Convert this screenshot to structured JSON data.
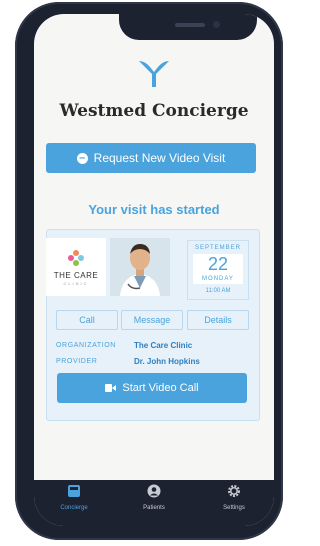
{
  "app": {
    "title": "Westmed Concierge"
  },
  "actions": {
    "request_visit": "Request New Video Visit"
  },
  "visit": {
    "status": "Your visit has started",
    "clinic_logo_text": "THE CARE",
    "clinic_logo_sub": "CLINIC",
    "date": {
      "month": "SEPTEMBER",
      "day": "22",
      "weekday": "MONDAY",
      "time": "11:00 AM"
    },
    "buttons": {
      "call": "Call",
      "message": "Message",
      "details": "Details"
    },
    "organization_label": "ORGANIZATION",
    "organization_value": "The Care Clinic",
    "provider_label": "PROVIDER",
    "provider_value": "Dr. John Hopkins",
    "start_call": "Start Video Call"
  },
  "tabs": [
    {
      "label": "Concierge",
      "icon": "concierge-icon",
      "active": true
    },
    {
      "label": "Patients",
      "icon": "patient-icon",
      "active": false
    },
    {
      "label": "Settings",
      "icon": "gear-icon",
      "active": false
    }
  ],
  "colors": {
    "accent": "#4aa3dc",
    "phone_frame": "#1c2230",
    "card_bg": "#e6f1fa"
  }
}
